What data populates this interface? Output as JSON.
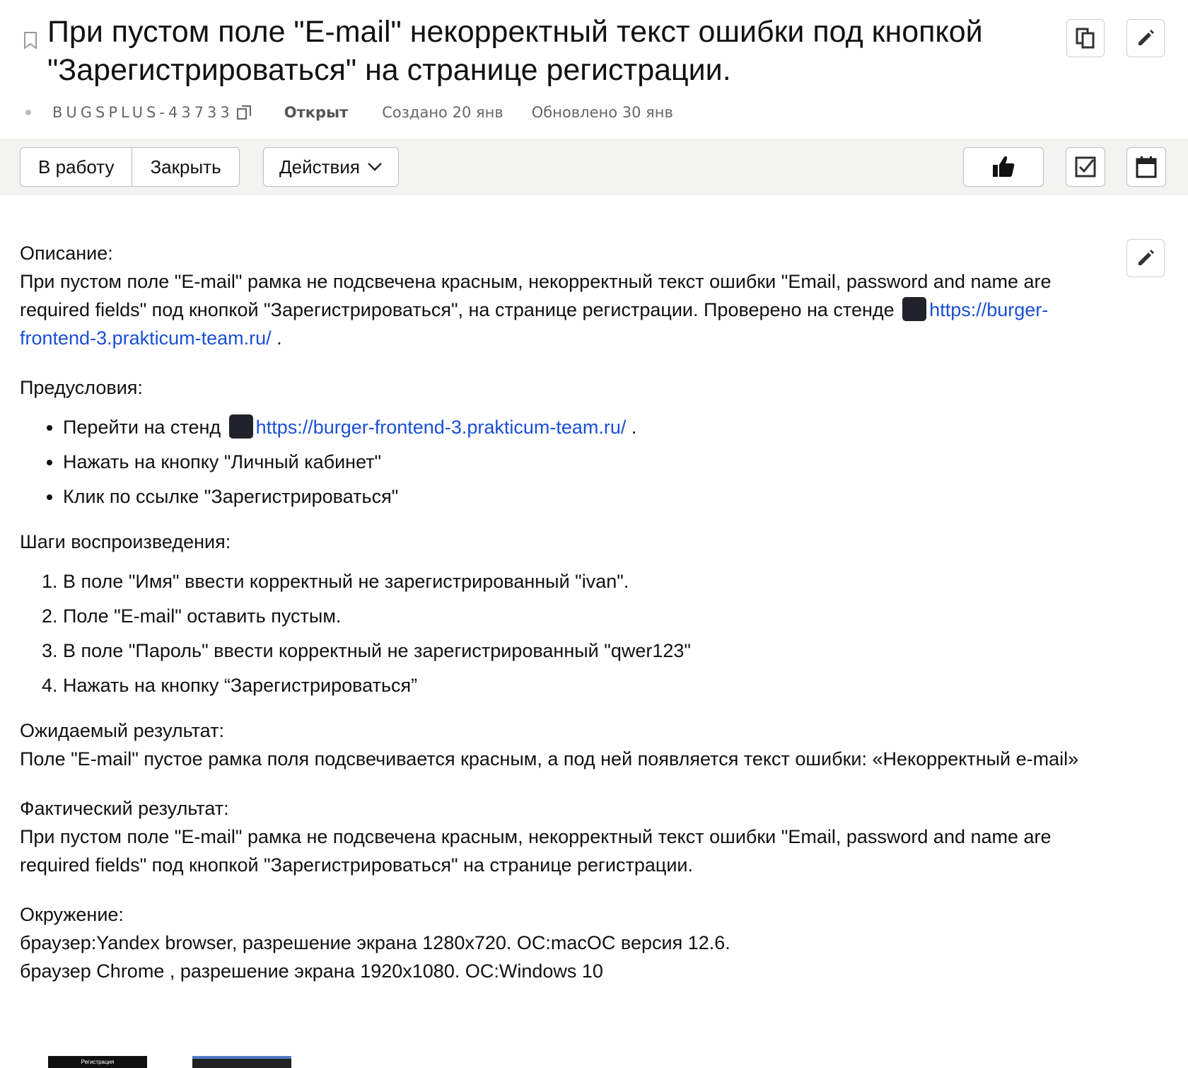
{
  "issue": {
    "title": "При пустом поле \"E-mail\" некорректный текст ошибки под кнопкой \"Зарегистрироваться\" на странице регистрации.",
    "key": "BUGSPLUS-43733",
    "status": "Открыт",
    "created": "Создано 20 янв",
    "updated": "Обновлено 30 янв"
  },
  "toolbar": {
    "in_work": "В работу",
    "close": "Закрыть",
    "actions": "Действия"
  },
  "icons": {
    "bookmark": "bookmark-icon",
    "copy": "copy-icon",
    "edit": "pencil-icon",
    "like": "thumbs-up-icon",
    "checklist": "checkbox-icon",
    "calendar": "calendar-icon",
    "react": "react-logo-icon"
  },
  "description": {
    "label": "Описание:",
    "text1": "При пустом поле \"E-mail\" рамка не подсвечена красным, некорректный текст ошибки \"Email, password and name are required fields\" под кнопкой \"Зарегистрироваться\", на странице регистрации. Проверено на стенде ",
    "link": "https://burger-frontend-3.prakticum-team.ru/",
    "after_link": " ."
  },
  "preconditions": {
    "label": "Предусловия:",
    "item1_prefix": "Перейти на стенд ",
    "item1_link": "https://burger-frontend-3.prakticum-team.ru/",
    "item1_suffix": " .",
    "item2": "Нажать на кнопку \"Личный кабинет\"",
    "item3": "Клик по ссылке \"Зарегистрироваться\""
  },
  "steps": {
    "label": "Шаги воспроизведения:",
    "items": [
      "В поле \"Имя\" ввести корректный не зарегистрированный \"ivan\".",
      "Поле \"E-mail\" оставить пустым.",
      "В поле \"Пароль\" ввести корректный не зарегистрированный \"qwer123\"",
      "Нажать на кнопку “Зарегистрироваться”"
    ]
  },
  "expected": {
    "label": "Ожидаемый результат:",
    "text": "Поле \"E-mail\" пустое рамка поля подсвечивается красным, а под ней появляется текст ошибки: «Некорректный e-mail»"
  },
  "actual": {
    "label": "Фактический результат:",
    "text": "При пустом поле \"E-mail\" рамка не подсвечена красным, некорректный текст ошибки \"Email, password and name are required fields\" под кнопкой \"Зарегистрироваться\" на странице регистрации."
  },
  "environment": {
    "label": "Окружение:",
    "line1": "браузер:Yandex browser, разрешение экрана 1280x720. ОС:macОС версия 12.6.",
    "line2": "браузер Chrome , разрешение экрана 1920x1080. ОС:Windows 10"
  },
  "attachments": {
    "thumb1_text": "Регистрация"
  },
  "colors": {
    "link": "#1a4fd6",
    "toolbar_bg": "#f3f3f2"
  }
}
